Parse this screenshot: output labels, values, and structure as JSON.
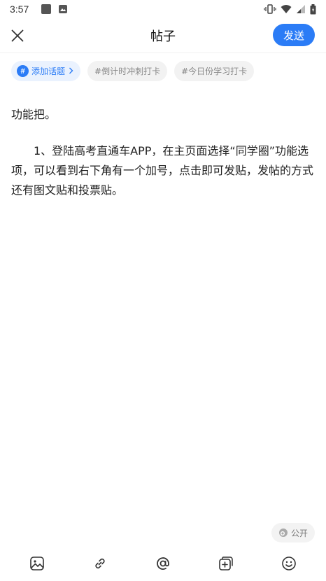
{
  "status_bar": {
    "time": "3:57"
  },
  "header": {
    "title": "帖子",
    "send_label": "发送"
  },
  "topics": {
    "add_label": "添加话题",
    "add_icon": "#",
    "suggestions": [
      "#倒计时冲刺打卡",
      "#今日份学习打卡"
    ]
  },
  "editor": {
    "paragraphs": [
      "功能把。",
      "1、登陆高考直通车APP，在主页面选择“同学圈”功能选项，可以看到右下角有一个加号，点击即可发贴，发帖的方式还有图文贴和投票贴。"
    ]
  },
  "visibility": {
    "label": "公开"
  },
  "colors": {
    "accent": "#2b7cf6",
    "chip_bg": "#f2f2f2"
  }
}
